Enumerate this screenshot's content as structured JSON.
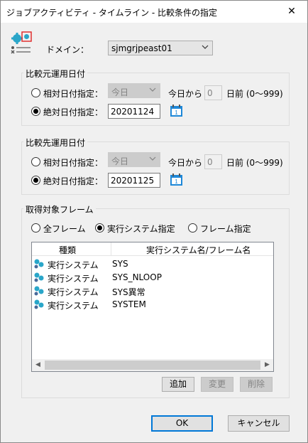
{
  "window": {
    "title": "ジョブアクティビティ - タイムライン - 比較条件の指定",
    "close_glyph": "✕"
  },
  "domain": {
    "label": "ドメイン：",
    "value": "sjmgrjpeast01"
  },
  "source_date": {
    "title": "比較元運用日付",
    "relative": {
      "label": "相対日付指定：",
      "select_value": "今日",
      "from_label": "今日から",
      "days_value": "0",
      "days_suffix": "日前 (0〜999)",
      "selected": false
    },
    "absolute": {
      "label": "絶対日付指定：",
      "date_value": "20201124",
      "selected": true
    }
  },
  "target_date": {
    "title": "比較先運用日付",
    "relative": {
      "label": "相対日付指定：",
      "select_value": "今日",
      "from_label": "今日から",
      "days_value": "0",
      "days_suffix": "日前 (0〜999)",
      "selected": false
    },
    "absolute": {
      "label": "絶対日付指定：",
      "date_value": "20201125",
      "selected": true
    }
  },
  "frames": {
    "title": "取得対象フレーム",
    "options": [
      {
        "label": "全フレーム",
        "selected": false
      },
      {
        "label": "実行システム指定",
        "selected": true
      },
      {
        "label": "フレーム指定",
        "selected": false
      }
    ],
    "columns": [
      "種類",
      "実行システム名/フレーム名"
    ],
    "rows": [
      {
        "type": "実行システム",
        "name": "SYS"
      },
      {
        "type": "実行システム",
        "name": "SYS_NLOOP"
      },
      {
        "type": "実行システム",
        "name": "SYS異常"
      },
      {
        "type": "実行システム",
        "name": "SYSTEM"
      }
    ],
    "add_label": "追加",
    "change_label": "変更",
    "delete_label": "削除"
  },
  "footer": {
    "ok_label": "OK",
    "cancel_label": "キャンセル"
  },
  "colors": {
    "accent": "#0078d7",
    "icon_teal": "#2aa6c9",
    "icon_red": "#e03030"
  }
}
